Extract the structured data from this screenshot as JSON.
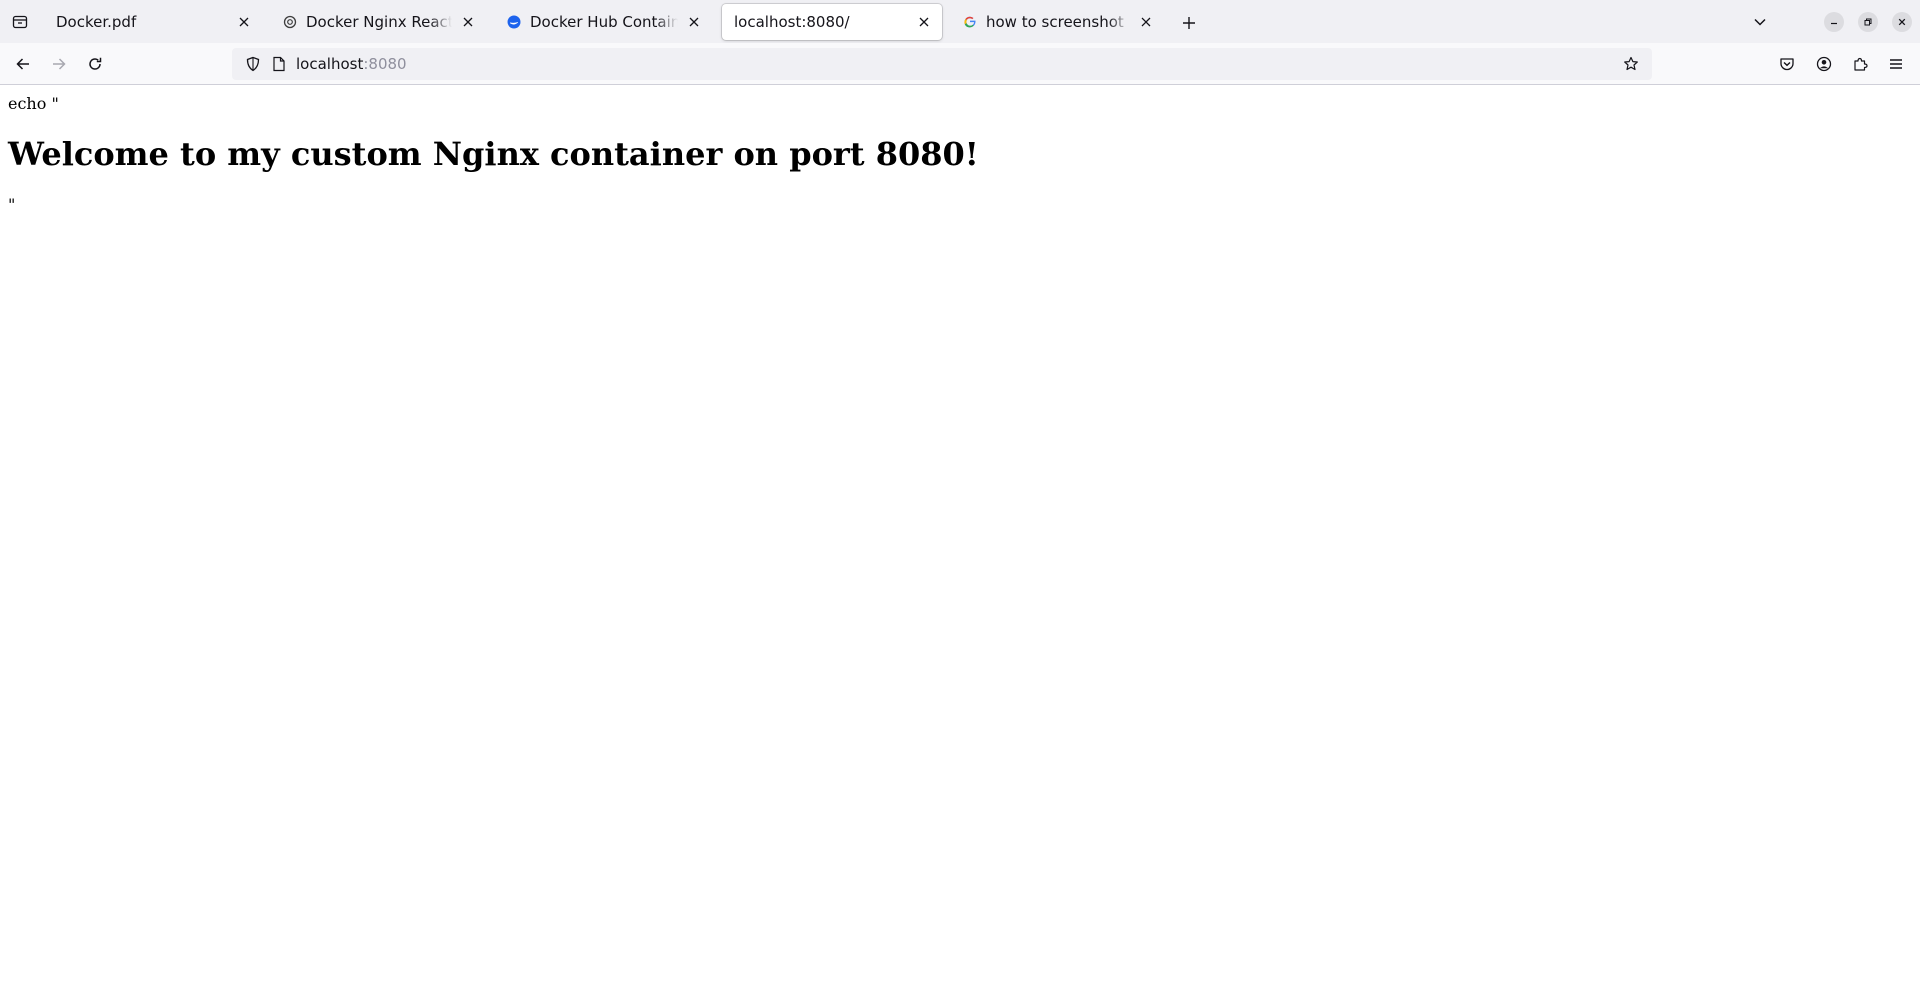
{
  "browser": {
    "tabs": [
      {
        "title": "Docker.pdf",
        "favicon": "none",
        "active": false
      },
      {
        "title": "Docker Nginx React Problem",
        "favicon": "openai-icon",
        "active": false
      },
      {
        "title": "Docker Hub Container Image",
        "favicon": "docker-icon",
        "active": false
      },
      {
        "title": "localhost:8080/",
        "favicon": "none",
        "active": true
      },
      {
        "title": "how to screenshot in ubuntu",
        "favicon": "google-icon",
        "active": false
      }
    ],
    "url": {
      "host": "localhost",
      "port": ":8080"
    }
  },
  "page": {
    "line1": "echo \"",
    "heading": "Welcome to my custom Nginx container on port 8080!",
    "line2": "\""
  },
  "colors": {
    "tabstrip_bg": "#f0f0f4",
    "navbar_bg": "#f9f9fb",
    "urlbar_bg": "#f0f0f4",
    "text": "#15141a",
    "muted": "#8f8f9d"
  }
}
